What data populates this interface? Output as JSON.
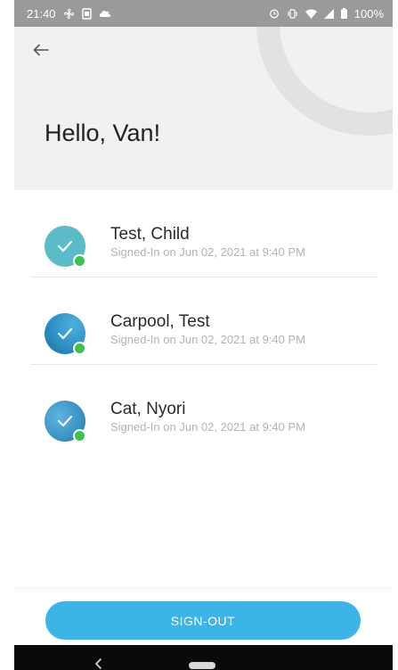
{
  "status_bar": {
    "time": "21:40",
    "battery": "100%",
    "icons_left": [
      "fan-icon",
      "sim-icon",
      "cloud-icon"
    ],
    "icons_right": [
      "alarm-icon",
      "vibrate-icon",
      "wifi-icon",
      "signal-icon",
      "battery-icon"
    ]
  },
  "header": {
    "greeting": "Hello, Van!"
  },
  "children": [
    {
      "name": "Test, Child",
      "status": "Signed-In on Jun 02, 2021 at 9:40 PM"
    },
    {
      "name": "Carpool, Test",
      "status": "Signed-In on Jun 02, 2021 at 9:40 PM"
    },
    {
      "name": "Cat, Nyori",
      "status": "Signed-In on Jun 02, 2021 at 9:40 PM"
    }
  ],
  "footer": {
    "signout_label": "SIGN-OUT"
  },
  "colors": {
    "status_bar": "#9a9a9a",
    "header_bg": "#f1f1f1",
    "accent": "#3cb4e8",
    "online": "#3cc152",
    "avatar_1": "#5bbcc9",
    "avatar_2": "#2d8fc4",
    "avatar_3": "#3a93c6"
  }
}
